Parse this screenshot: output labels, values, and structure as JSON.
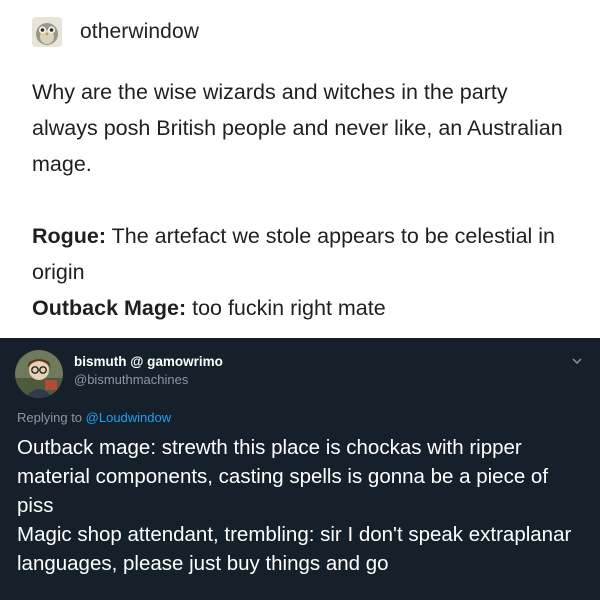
{
  "tumblr": {
    "username": "otherwindow",
    "avatar_icon": "bird-avatar-icon",
    "post_text": "Why are the wise wizards and witches in the party always posh British people and never like, an Australian mage.",
    "dialogue": [
      {
        "speaker": "Rogue:",
        "line": " The artefact we stole appears to be celestial in origin"
      },
      {
        "speaker": "Outback Mage:",
        "line": " too fuckin right mate"
      }
    ]
  },
  "tweet": {
    "display_name": "bismuth @ gamowrimo",
    "handle": "@bismuthmachines",
    "avatar_icon": "profile-avatar-icon",
    "menu_icon": "chevron-down-icon",
    "replying_label": "Replying to ",
    "replying_to": "@Loudwindow",
    "lines": [
      "Outback mage: strewth this place is chockas with ripper material components, casting spells is gonna be a piece of piss",
      "Magic shop attendant, trembling: sir I don't speak extraplanar languages, please just buy things and go"
    ]
  },
  "colors": {
    "tweet_background": "#15202b",
    "tweet_secondary_text": "#8899a6",
    "mention_blue": "#1da1f2"
  }
}
